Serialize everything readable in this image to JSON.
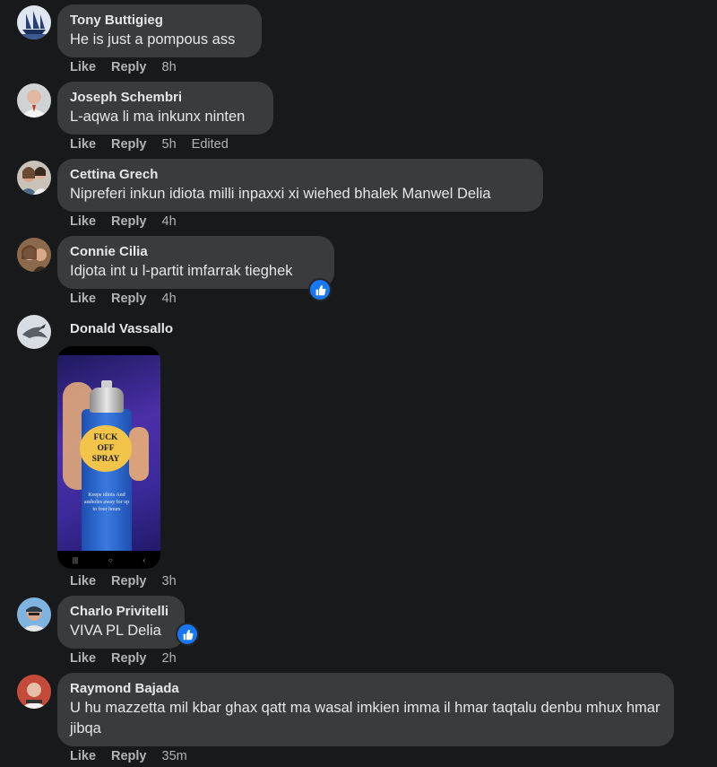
{
  "comments": [
    {
      "author": "Tony Buttigieg",
      "text": "He is just a pompous ass",
      "actions": {
        "like": "Like",
        "reply": "Reply",
        "time": "8h",
        "edited": ""
      }
    },
    {
      "author": "Joseph Schembri",
      "text": "L-aqwa li ma inkunx ninten",
      "actions": {
        "like": "Like",
        "reply": "Reply",
        "time": "5h",
        "edited": "Edited"
      }
    },
    {
      "author": "Cettina Grech",
      "text": "Nipreferi inkun idiota milli inpaxxi xi wiehed bhalek Manwel Delia",
      "actions": {
        "like": "Like",
        "reply": "Reply",
        "time": "4h",
        "edited": ""
      }
    },
    {
      "author": "Connie Cilia",
      "text": "Idjota int u l-partit imfarrak tieghek",
      "actions": {
        "like": "Like",
        "reply": "Reply",
        "time": "4h",
        "edited": ""
      },
      "reaction": "like-icon"
    },
    {
      "author": "Donald Vassallo",
      "text": "",
      "image": {
        "label_lines": [
          "FUCK",
          "OFF",
          "SPRAY"
        ],
        "small_text": "Keeps idiots And assholes away for up to four hours"
      },
      "actions": {
        "like": "Like",
        "reply": "Reply",
        "time": "3h",
        "edited": ""
      }
    },
    {
      "author": "Charlo Privitelli",
      "text": "VIVA PL Delia",
      "actions": {
        "like": "Like",
        "reply": "Reply",
        "time": "2h",
        "edited": ""
      },
      "reaction": "like-icon"
    },
    {
      "author": "Raymond Bajada",
      "text": "U hu mazzetta mil kbar ghax qatt ma wasal imkien imma il hmar taqtalu denbu mhux hmar jibqa",
      "actions": {
        "like": "Like",
        "reply": "Reply",
        "time": "35m",
        "edited": ""
      }
    }
  ],
  "colors": {
    "background": "#18191a",
    "bubble": "#3a3b3c",
    "text": "#e4e6eb",
    "meta": "#b0b3b8",
    "like_blue": "#1877f2"
  }
}
